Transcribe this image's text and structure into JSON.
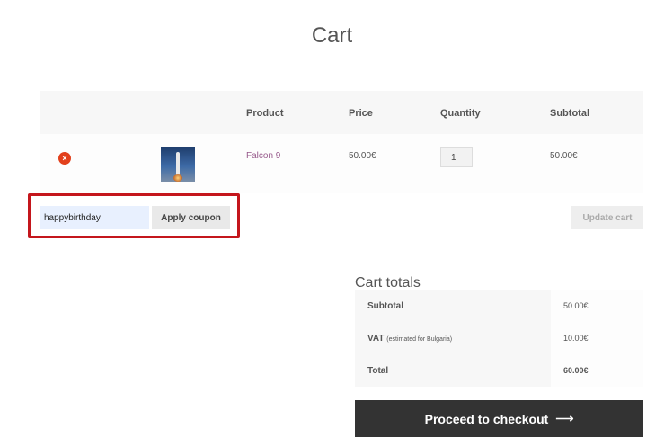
{
  "page": {
    "title": "Cart"
  },
  "cart_table": {
    "headers": {
      "product": "Product",
      "price": "Price",
      "quantity": "Quantity",
      "subtotal": "Subtotal"
    },
    "items": [
      {
        "name": "Falcon 9",
        "price": "50.00€",
        "quantity": "1",
        "subtotal": "50.00€",
        "remove_icon": "×"
      }
    ]
  },
  "coupon": {
    "value": "happybirthday",
    "apply_label": "Apply coupon"
  },
  "update_cart_label": "Update cart",
  "totals": {
    "title": "Cart totals",
    "rows": [
      {
        "label": "Subtotal",
        "note": "",
        "value": "50.00€"
      },
      {
        "label": "VAT",
        "note": "(estimated for Bulgaria)",
        "value": "10.00€"
      },
      {
        "label": "Total",
        "note": "",
        "value": "60.00€"
      }
    ]
  },
  "checkout": {
    "label": "Proceed to checkout",
    "arrow": "⟶"
  },
  "colors": {
    "accent_link": "#96588a",
    "remove": "#e2401c",
    "highlight": "#c4161c",
    "checkout_bg": "#333333"
  }
}
